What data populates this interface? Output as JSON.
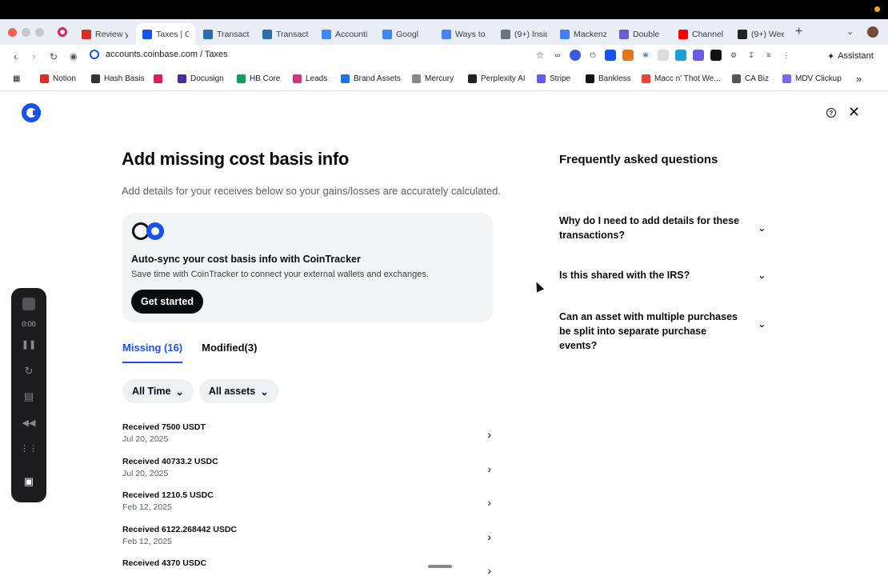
{
  "browser": {
    "tabs": [
      {
        "label": "Review y",
        "icon": "gmail-icon",
        "color": "#d93025"
      },
      {
        "label": "Taxes | C",
        "icon": "coinbase-icon",
        "color": "#1652f0",
        "active": true
      },
      {
        "label": "Transacti",
        "icon": "k-icon",
        "color": "#2b6cb0"
      },
      {
        "label": "Transacti",
        "icon": "k-icon",
        "color": "#2b6cb0"
      },
      {
        "label": "Accounti",
        "icon": "docs-icon",
        "color": "#4285f4"
      },
      {
        "label": "Googl",
        "icon": "docs-icon",
        "color": "#4285f4"
      },
      {
        "label": "Ways to",
        "icon": "docs-icon",
        "color": "#4285f4"
      },
      {
        "label": "(9+) Insid",
        "icon": "bowl-icon",
        "color": "#6b7280"
      },
      {
        "label": "Mackenz",
        "icon": "calendar-icon",
        "color": "#3b82f6"
      },
      {
        "label": "Double",
        "icon": "d-icon",
        "color": "#6d5bd0"
      },
      {
        "label": "Channel",
        "icon": "youtube-icon",
        "color": "#ff0000"
      },
      {
        "label": "(9+) Wee",
        "icon": "notion-icon",
        "color": "#222222"
      }
    ],
    "url": "accounts.coinbase.com / Taxes",
    "assistant_label": "Assistant",
    "bookmarks": [
      {
        "label": "Notion",
        "color": "#d93025"
      },
      {
        "label": "Hash Basis",
        "color": "#333"
      },
      {
        "label": "",
        "color": "#e01e5a"
      },
      {
        "label": "Docusign",
        "color": "#4b2ca0"
      },
      {
        "label": "HB Core",
        "color": "#0f9d58"
      },
      {
        "label": "Leads",
        "color": "#d63384"
      },
      {
        "label": "Brand Assets",
        "color": "#1a73e8"
      },
      {
        "label": "Mercury",
        "color": "#888"
      },
      {
        "label": "Perplexity AI",
        "color": "#222"
      },
      {
        "label": "Stripe",
        "color": "#635bff"
      },
      {
        "label": "Bankless",
        "color": "#111"
      },
      {
        "label": "Macc n' Thot We...",
        "color": "#ea4335"
      },
      {
        "label": "CA Biz",
        "color": "#555"
      },
      {
        "label": "MDV Clickup",
        "color": "#7b68ee"
      }
    ]
  },
  "page": {
    "title": "Add missing cost basis info",
    "subtitle": "Add details for your receives below so your gains/losses are accurately calculated.",
    "card": {
      "title": "Auto-sync your cost basis info with CoinTracker",
      "description": "Save time with CoinTracker to connect your external wallets and exchanges.",
      "button": "Get started"
    },
    "tabs": [
      {
        "label": "Missing (16)",
        "active": true
      },
      {
        "label": "Modified(3)",
        "active": false
      }
    ],
    "filters": [
      {
        "label": "All Time"
      },
      {
        "label": "All assets"
      }
    ],
    "transactions": [
      {
        "title": "Received 7500 USDT",
        "date": "Jul 20, 2025"
      },
      {
        "title": "Received 40733.2 USDC",
        "date": "Jul 20, 2025"
      },
      {
        "title": "Received 1210.5 USDC",
        "date": "Feb 12, 2025"
      },
      {
        "title": "Received 6122.268442 USDC",
        "date": "Feb 12, 2025"
      },
      {
        "title": "Received 4370 USDC",
        "date": ""
      }
    ],
    "faq": {
      "title": "Frequently asked questions",
      "items": [
        {
          "question": "Why do I need to add details for these transactions?"
        },
        {
          "question": "Is this shared with the IRS?"
        },
        {
          "question": "Can an asset with multiple purchases be split into separate purchase events?"
        }
      ]
    }
  },
  "recorder": {
    "time": "0:00"
  },
  "colors": {
    "accent": "#1652f0",
    "text": "#0a0b0d",
    "muted": "#5b616e"
  }
}
